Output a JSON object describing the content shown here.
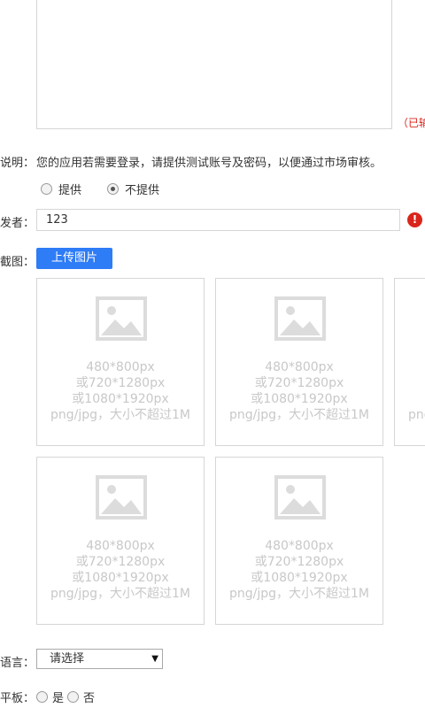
{
  "form": {
    "char_count": "（已输",
    "desc_label": "说明：",
    "desc_text": "您的应用若需要登录，请提供测试账号及密码，以便通过市场审核。",
    "account_options": [
      {
        "label": "提供",
        "checked": false
      },
      {
        "label": "不提供",
        "checked": true
      }
    ],
    "developer_label": "发者：",
    "developer_value": "123",
    "warn_icon": "!",
    "screenshot_label": "截图：",
    "upload_label": "上传图片",
    "screenshot_hint": [
      "480*800px",
      "或720*1280px",
      "或1080*1920px",
      "png/jpg，大小不超过1M"
    ],
    "language_label": "语言：",
    "language_value": "请选择",
    "tablet_label": "平板：",
    "tablet_yes": "是",
    "tablet_no": "否"
  },
  "colors": {
    "primary": "#2e7cf6",
    "error": "#d9261c",
    "border": "#d6d6d6",
    "placeholder": "#c8c8c8"
  },
  "icons": {
    "image_placeholder": "image-icon",
    "warning": "warning-icon",
    "dropdown": "chevron-down-icon"
  }
}
